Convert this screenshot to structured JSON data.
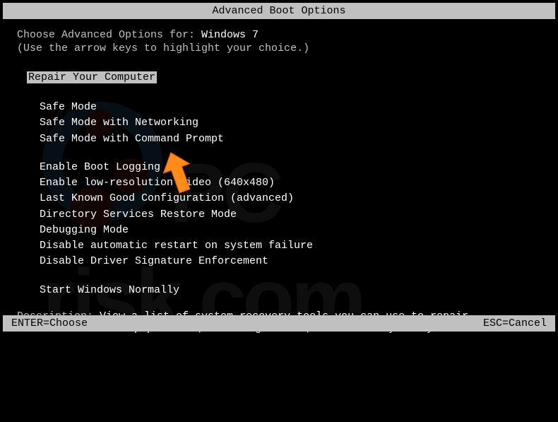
{
  "title": "Advanced Boot Options",
  "prompt": {
    "prefix": "Choose Advanced Options for: ",
    "os": "Windows 7",
    "hint": "(Use the arrow keys to highlight your choice.)"
  },
  "selected_option": "Repair Your Computer",
  "options_group_1": [
    "Safe Mode",
    "Safe Mode with Networking",
    "Safe Mode with Command Prompt"
  ],
  "options_group_2": [
    "Enable Boot Logging",
    "Enable low-resolution video (640x480)",
    "Last Known Good Configuration (advanced)",
    "Directory Services Restore Mode",
    "Debugging Mode",
    "Disable automatic restart on system failure",
    "Disable Driver Signature Enforcement"
  ],
  "options_group_3": [
    "Start Windows Normally"
  ],
  "description": {
    "label": "Description: ",
    "line1": "View a list of system recovery tools you can use to repair",
    "line2": "startup problems, run diagnostics, or restore your system."
  },
  "footer": {
    "left": "ENTER=Choose",
    "right": "ESC=Cancel"
  }
}
